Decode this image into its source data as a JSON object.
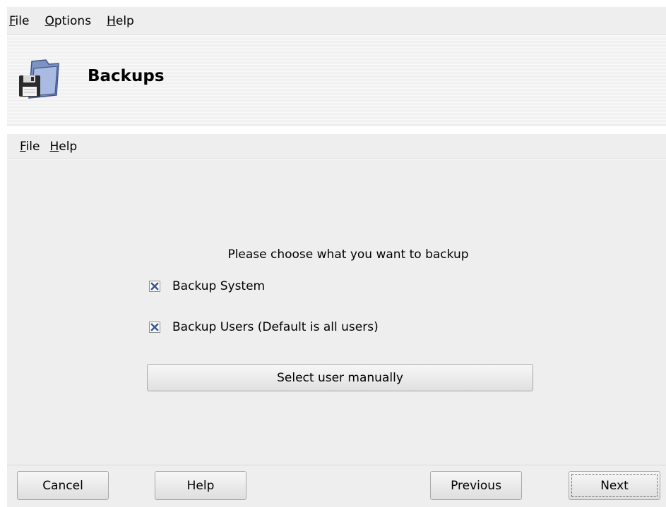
{
  "menubar_top": {
    "items": [
      {
        "label": "File",
        "mnemonic": "F",
        "rest": "ile"
      },
      {
        "label": "Options",
        "mnemonic": "O",
        "rest": "ptions"
      },
      {
        "label": "Help",
        "mnemonic": "H",
        "rest": "elp"
      }
    ]
  },
  "banner": {
    "title": "Backups",
    "icon": "backup-folder-floppy-icon"
  },
  "menubar_inner": {
    "items": [
      {
        "label": "File",
        "mnemonic": "F",
        "rest": "ile"
      },
      {
        "label": "Help",
        "mnemonic": "H",
        "rest": "elp"
      }
    ]
  },
  "content": {
    "prompt": "Please choose what you want to backup",
    "options": [
      {
        "label": "Backup System",
        "checked": true
      },
      {
        "label": "Backup Users (Default is all users)",
        "checked": true
      }
    ],
    "select_button": "Select user manually"
  },
  "footer": {
    "cancel": "Cancel",
    "help": "Help",
    "previous": "Previous",
    "next": "Next"
  },
  "colors": {
    "checkmark": "#3a5a9a",
    "panel_bg": "#eeeeee"
  }
}
